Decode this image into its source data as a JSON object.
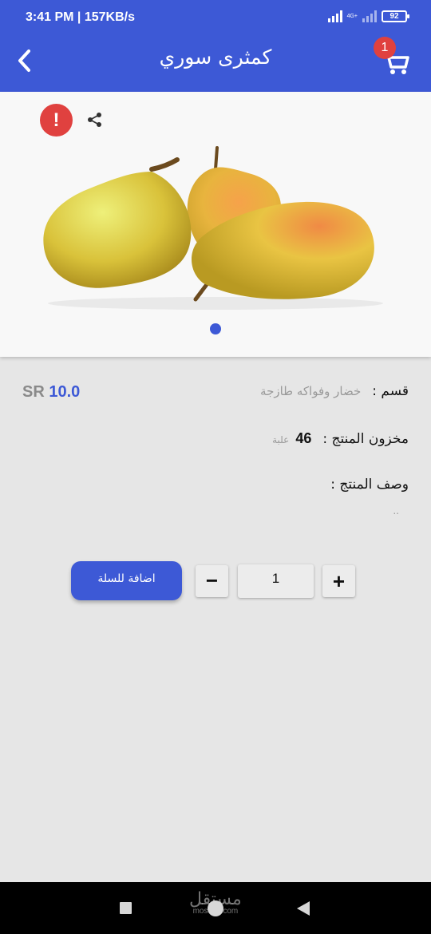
{
  "status_bar": {
    "time": "3:41 PM | 157KB/s",
    "network_type": "4G+",
    "battery": "92"
  },
  "app_bar": {
    "title": "كمثرى سوري",
    "cart_count": "1",
    "back_icon": "chevron-left-icon",
    "cart_icon": "shopping-cart-icon"
  },
  "product": {
    "image": "pears-photo",
    "alert_icon": "!",
    "share_icon": "share-icon",
    "price_currency": "SR",
    "price_value": "10.0",
    "category_label": "قسم :",
    "category_value": "خضار وفواكه طازجة",
    "stock_label": "مخزون المنتج :",
    "stock_value": "46",
    "stock_unit": "علبة",
    "description_label": "وصف المنتج :",
    "description_text": ".."
  },
  "cart_controls": {
    "add_to_cart_label": "اضافة للسلة",
    "minus_label": "−",
    "quantity": "1",
    "plus_label": "+"
  },
  "nav_bar": {
    "watermark_arabic": "مستقل",
    "watermark_latin": "mostaql.com"
  },
  "colors": {
    "primary": "#3d59d6",
    "alert": "#e0413f",
    "background": "#e6e6e6"
  }
}
